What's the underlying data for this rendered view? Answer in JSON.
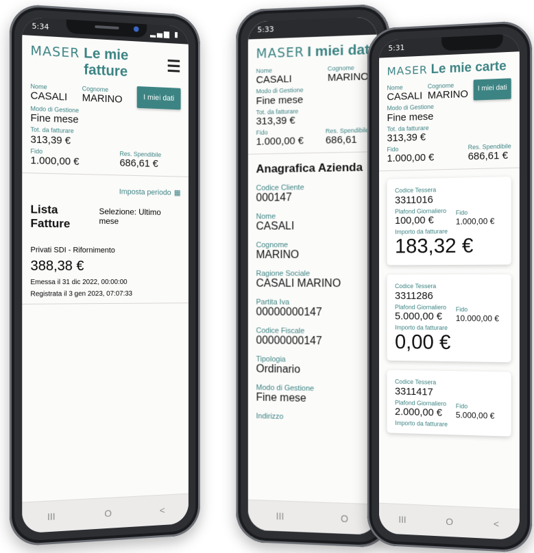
{
  "phone1": {
    "status_time": "5:34",
    "brand": "MASER",
    "page_title": "Le mie fatture",
    "button": "I miei dati",
    "fields": {
      "nome_label": "Nome",
      "nome": "CASALI",
      "cognome_label": "Cognome",
      "cognome": "MARINO",
      "modo_label": "Modo di Gestione",
      "modo": "Fine mese",
      "tot_label": "Tot. da fatturare",
      "tot": "313,39 €",
      "fido_label": "Fido",
      "fido": "1.000,00 €",
      "res_label": "Res. Spendibile",
      "res": "686,61 €"
    },
    "imposta_periodo": "Imposta periodo",
    "lista_title": "Lista Fatture",
    "selezione": "Selezione: Ultimo mese",
    "invoice": {
      "type": "Privati SDI - Rifornimento",
      "amount": "388,38 €",
      "emessa": "Emessa il 31 dic 2022, 00:00:00",
      "registrata": "Registrata il 3 gen 2023, 07:07:33"
    }
  },
  "phone2": {
    "status_time": "5:33",
    "brand": "MASER",
    "page_title": "I miei dati",
    "fields": {
      "nome_label": "Nome",
      "nome": "CASALI",
      "cognome_label": "Cognome",
      "cognome": "MARINO",
      "modo_label": "Modo di Gestione",
      "modo": "Fine mese",
      "tot_label": "Tot. da fatturare",
      "tot": "313,39 €",
      "fido_label": "Fido",
      "fido": "1.000,00 €",
      "res_label": "Res. Spendibile",
      "res": "686,61"
    },
    "anagrafica_title": "Anagrafica Azienda",
    "anagrafica": [
      {
        "label": "Codice Cliente",
        "value": "000147"
      },
      {
        "label": "Nome",
        "value": "CASALI"
      },
      {
        "label": "Cognome",
        "value": "MARINO"
      },
      {
        "label": "Ragione Sociale",
        "value": "CASALI MARINO"
      },
      {
        "label": "Partita Iva",
        "value": "00000000147"
      },
      {
        "label": "Codice Fiscale",
        "value": "00000000147"
      },
      {
        "label": "Tipologia",
        "value": "Ordinario"
      },
      {
        "label": "Modo di Gestione",
        "value": "Fine mese"
      },
      {
        "label": "Indirizzo",
        "value": ""
      }
    ]
  },
  "phone3": {
    "status_time": "5:31",
    "brand": "MASER",
    "page_title": "Le mie carte",
    "button": "I miei dati",
    "fields": {
      "nome_label": "Nome",
      "nome": "CASALI",
      "cognome_label": "Cognome",
      "cognome": "MARINO",
      "modo_label": "Modo di Gestione",
      "modo": "Fine mese",
      "tot_label": "Tot. da fatturare",
      "tot": "313,39 €",
      "fido_label": "Fido",
      "fido": "1.000,00 €",
      "res_label": "Res. Spendibile",
      "res": "686,61 €"
    },
    "cards": [
      {
        "codice_label": "Codice Tessera",
        "codice": "3311016",
        "plafond_label": "Plafond Giornaliero",
        "plafond": "100,00 €",
        "fido_label": "Fido",
        "fido": "1.000,00 €",
        "importo_label": "Importo da fatturare",
        "importo": "183,32 €"
      },
      {
        "codice_label": "Codice Tessera",
        "codice": "3311286",
        "plafond_label": "Plafond Giornaliero",
        "plafond": "5.000,00 €",
        "fido_label": "Fido",
        "fido": "10.000,00 €",
        "importo_label": "Importo da fatturare",
        "importo": "0,00 €"
      },
      {
        "codice_label": "Codice Tessera",
        "codice": "3311417",
        "plafond_label": "Plafond Giornaliero",
        "plafond": "2.000,00 €",
        "fido_label": "Fido",
        "fido": "5.000,00 €",
        "importo_label": "Importo da fatturare",
        "importo": ""
      }
    ]
  },
  "nav": {
    "recent": "III",
    "home": "O",
    "back": "<"
  },
  "accent_color": "#3c8483"
}
